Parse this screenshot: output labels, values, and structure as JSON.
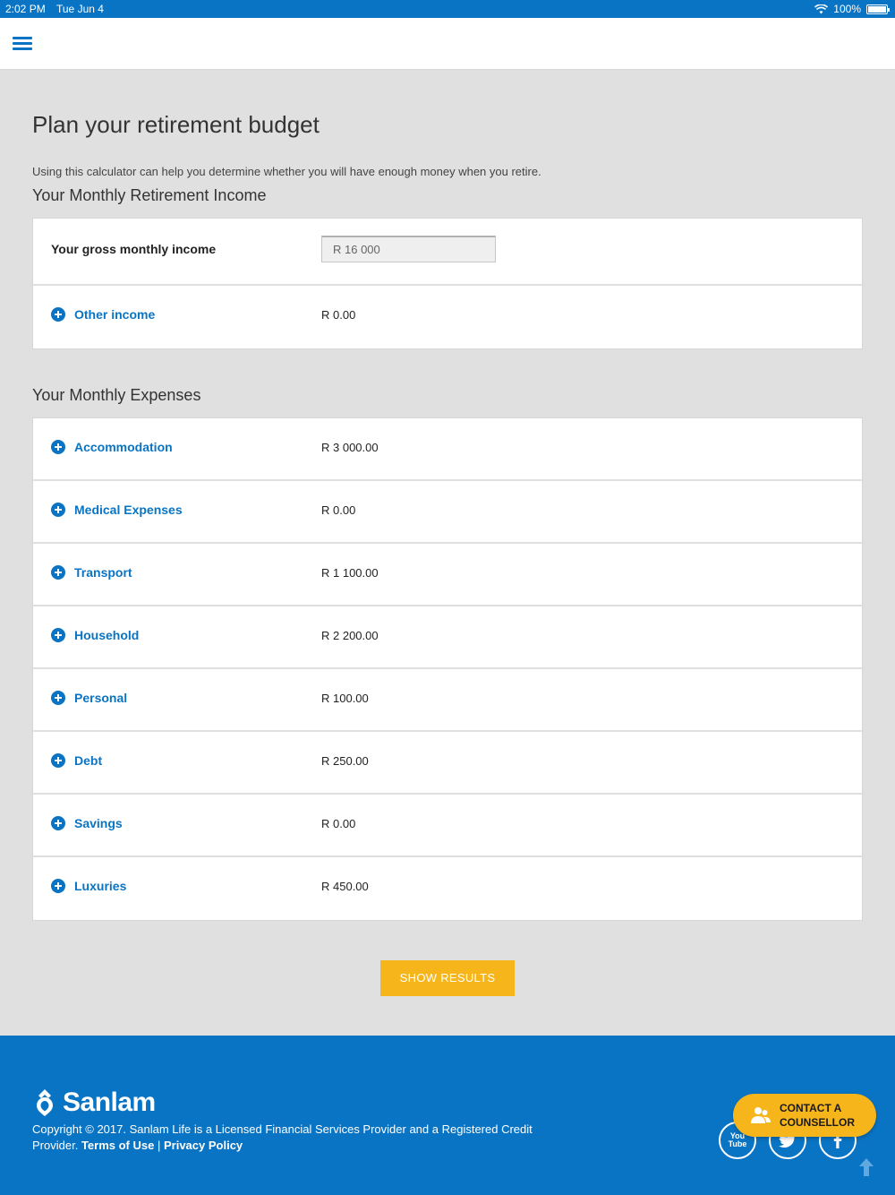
{
  "status_bar": {
    "time": "2:02 PM",
    "date": "Tue Jun 4",
    "battery": "100%"
  },
  "page": {
    "title": "Plan your retirement budget",
    "intro": "Using this calculator can help you determine whether you will have enough money when you retire."
  },
  "income": {
    "heading": "Your Monthly Retirement Income",
    "gross_label": "Your gross monthly income",
    "gross_value": "R 16 000",
    "other_label": "Other income",
    "other_value": "R 0.00"
  },
  "expenses": {
    "heading": "Your Monthly Expenses",
    "items": [
      {
        "label": "Accommodation",
        "value": "R 3 000.00"
      },
      {
        "label": "Medical Expenses",
        "value": "R 0.00"
      },
      {
        "label": "Transport",
        "value": "R 1 100.00"
      },
      {
        "label": "Household",
        "value": "R 2 200.00"
      },
      {
        "label": "Personal",
        "value": "R 100.00"
      },
      {
        "label": "Debt",
        "value": "R 250.00"
      },
      {
        "label": "Savings",
        "value": "R 0.00"
      },
      {
        "label": "Luxuries",
        "value": "R 450.00"
      }
    ]
  },
  "actions": {
    "show_results": "SHOW RESULTS"
  },
  "footer": {
    "brand": "Sanlam",
    "copyright_text": "Copyright © 2017. Sanlam Life is a Licensed Financial Services Provider and a Registered Credit Provider.",
    "terms": "Terms of Use",
    "separator": "|",
    "privacy": "Privacy Policy",
    "contact_line1": "CONTACT A",
    "contact_line2": "COUNSELLOR",
    "youtube_label": "You Tube"
  },
  "colors": {
    "brand_blue": "#0a74c4",
    "accent_yellow": "#f7b51c",
    "background": "#e0e0e0"
  }
}
